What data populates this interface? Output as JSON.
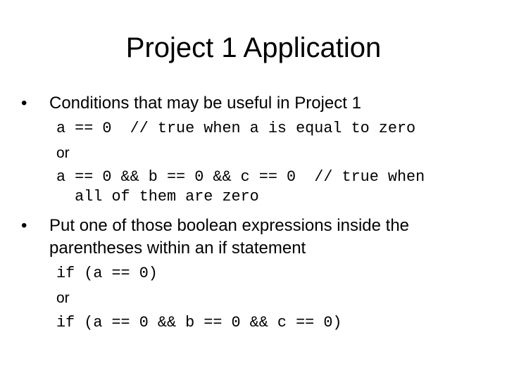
{
  "slide": {
    "title": "Project 1 Application",
    "bullets": [
      {
        "marker": "•",
        "text": "Conditions that may be useful in Project 1",
        "lines": [
          {
            "type": "code",
            "text": "a == 0  // true when a is equal to zero"
          },
          {
            "type": "text",
            "text": "or"
          },
          {
            "type": "code",
            "text": "a == 0 && b == 0 && c == 0  // true when"
          },
          {
            "type": "code",
            "text": "  all of them are zero"
          }
        ]
      },
      {
        "marker": "•",
        "text_line1": "Put one of those boolean expressions inside the",
        "text_line2": "parentheses within an if statement",
        "lines": [
          {
            "type": "code",
            "text": "if (a == 0)"
          },
          {
            "type": "text",
            "text": "or"
          },
          {
            "type": "code",
            "text": "if (a == 0 && b == 0 && c == 0)"
          }
        ]
      }
    ]
  }
}
